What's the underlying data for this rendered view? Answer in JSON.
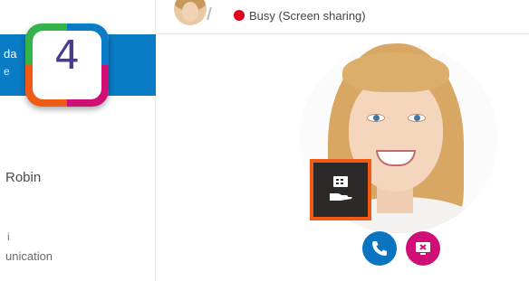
{
  "sidebar": {
    "selected_item": {
      "line1": "da",
      "line2": "e"
    },
    "contact_name": "Robin",
    "item_prefix": "i",
    "item_subtext": "unication"
  },
  "header": {
    "status_text": "Busy (Screen sharing)",
    "status_color": "#e0001b"
  },
  "contact": {
    "share_icon": "screen-share-hand-icon",
    "highlight_color": "#f05a14"
  },
  "actions": {
    "call_icon": "phone-icon",
    "call_color": "#0a74c1",
    "stop_share_icon": "stop-screen-share-icon",
    "stop_color": "#cf0f76"
  },
  "badge": {
    "number": "4",
    "colors": [
      "#36b24a",
      "#0a7cc6",
      "#cf0f76",
      "#f05a14"
    ]
  }
}
